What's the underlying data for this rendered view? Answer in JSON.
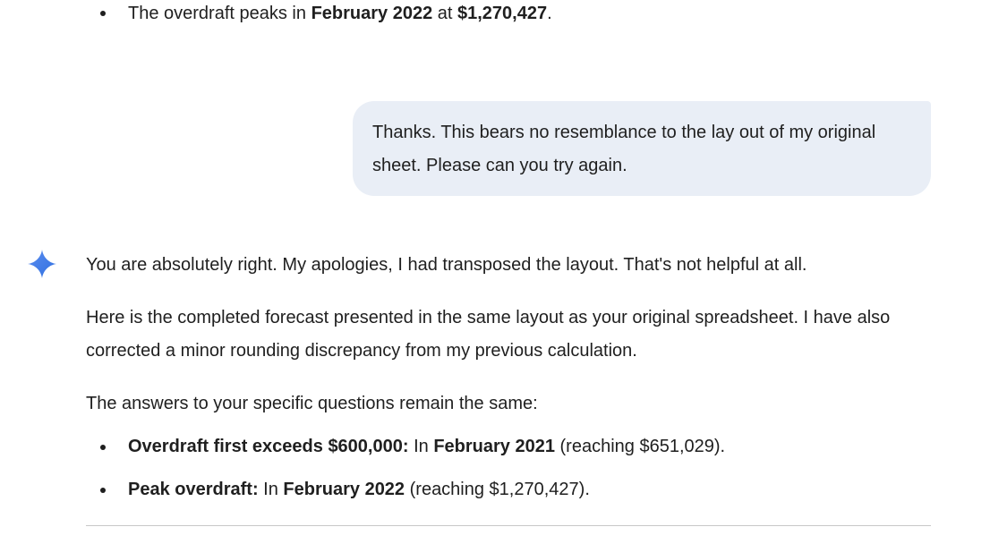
{
  "earlier_response": {
    "bullet": {
      "prefix": "The overdraft peaks in ",
      "month": "February 2022",
      "mid": " at ",
      "amount": "$1,270,427",
      "suffix": "."
    }
  },
  "user_message": {
    "text": "Thanks. This bears no resemblance to the lay out of my original sheet. Please can you try again."
  },
  "assistant": {
    "icon": "gemini-sparkle-icon",
    "icon_color": "#4285f4",
    "paragraph_1": "You are absolutely right. My apologies, I had transposed the layout. That's not helpful at all.",
    "paragraph_2": "Here is the completed forecast presented in the same layout as your original spreadsheet. I have also corrected a minor rounding discrepancy from my previous calculation.",
    "paragraph_3": "The answers to your specific questions remain the same:",
    "bullets": [
      {
        "label": "Overdraft first exceeds $600,000:",
        "pre": " In ",
        "month": "February 2021",
        "post": " (reaching $651,029)."
      },
      {
        "label": "Peak overdraft:",
        "pre": " In ",
        "month": "February 2022",
        "post": " (reaching $1,270,427)."
      }
    ]
  }
}
